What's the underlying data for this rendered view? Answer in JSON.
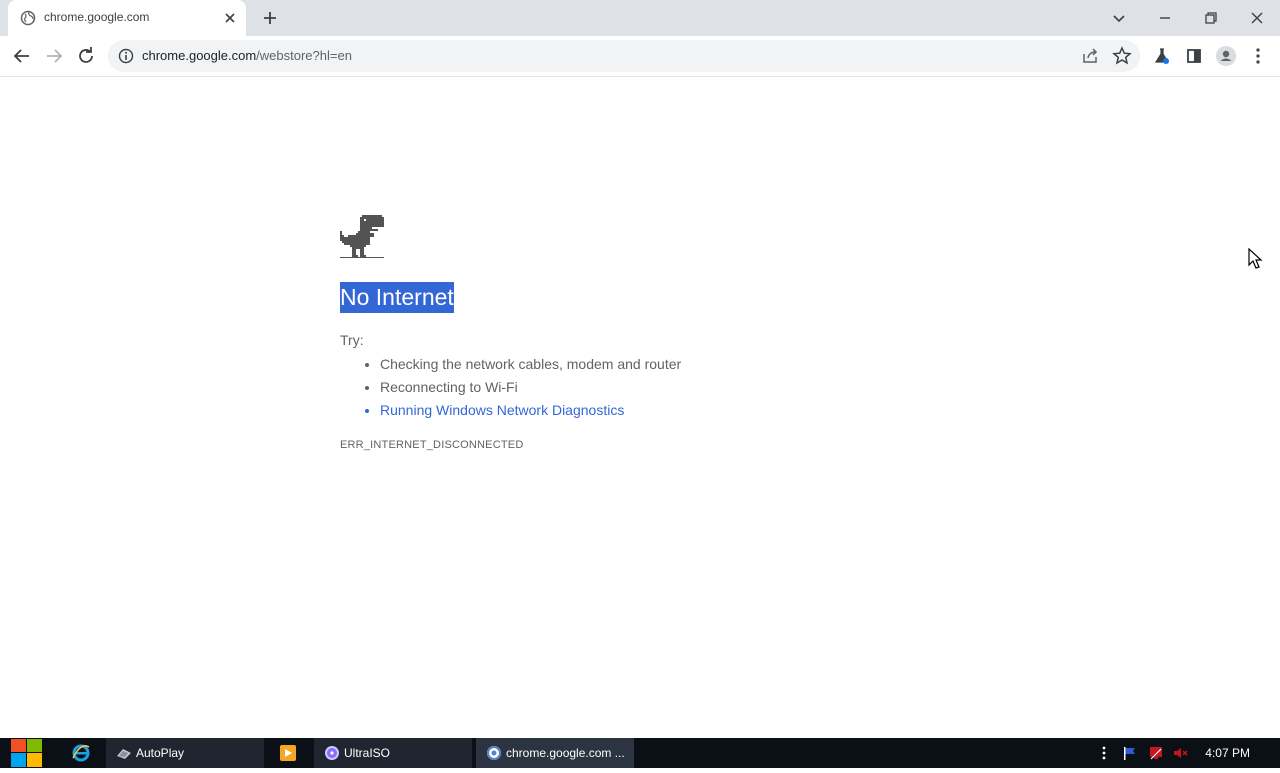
{
  "browser": {
    "tab": {
      "title": "chrome.google.com"
    },
    "address_bar": {
      "host": "chrome.google.com",
      "path": "/webstore?hl=en"
    }
  },
  "error_page": {
    "heading": "No Internet",
    "try_label": "Try:",
    "suggestions": [
      "Checking the network cables, modem and router",
      "Reconnecting to Wi-Fi",
      "Running Windows Network Diagnostics"
    ],
    "error_code": "ERR_INTERNET_DISCONNECTED"
  },
  "taskbar": {
    "items": [
      {
        "label": "AutoPlay",
        "icon": "autoplay-icon"
      },
      {
        "label": "",
        "icon": "media-player-icon"
      },
      {
        "label": "UltraISO",
        "icon": "ultraiso-icon"
      },
      {
        "label": "chrome.google.com ...",
        "icon": "chrome-icon"
      }
    ],
    "clock": "4:07 PM"
  },
  "colors": {
    "accent": "#3367d6",
    "taskbar": "#0b1016",
    "tab_strip": "#dee1e6"
  }
}
